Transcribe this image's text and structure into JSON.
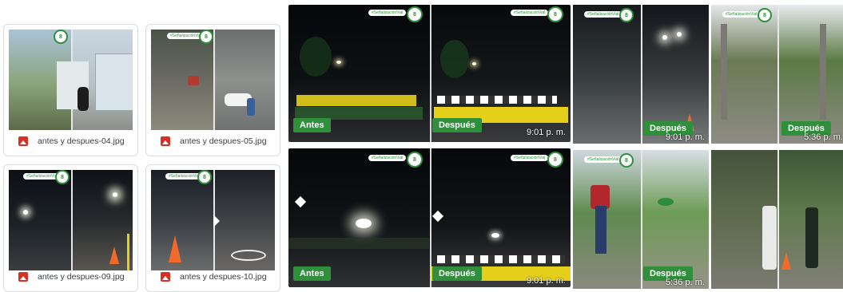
{
  "cards": [
    {
      "filename": "antes y despues-04.jpg"
    },
    {
      "filename": "antes y despues-05.jpg"
    },
    {
      "filename": "antes y despues-09.jpg"
    },
    {
      "filename": "antes y despues-10.jpg"
    }
  ],
  "photos": {
    "before_label": "Antes",
    "after_label": "Después",
    "time_night": "9:01 p. m.",
    "time_evening": "5:36 p. m.",
    "brand_text": "#SeñalizaciónVial",
    "seal_text": "8"
  },
  "colors": {
    "badge_green": "#2f8f3a",
    "road_yellow": "#e6cf1a",
    "cone_orange": "#f06a2a",
    "file_icon_red": "#d93025"
  }
}
